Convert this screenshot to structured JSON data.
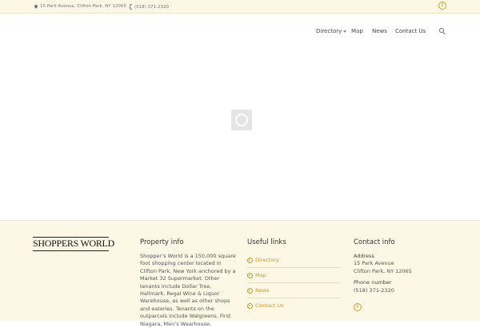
{
  "topbar": {
    "address": "15 Park Avenue, Clifton Park, NY 12065",
    "phone": "(518) 371-2320",
    "facebook_glyph": "f"
  },
  "nav": {
    "items": [
      "Directory",
      "Map",
      "News",
      "Contact Us"
    ]
  },
  "footer": {
    "logo_text": "SHOPPERS WORLD",
    "property": {
      "title": "Property info",
      "text": "Shopper’s World is a 150,000 square foot shopping center located in Clifton Park, New York anchored by a Market 32 Supermarket. Other tenants include Dollar Tree, Hallmark, Regal Wine & Liquor Warehouse, as well as other shops and eateries. Tenants on the outparcels include Walgreens, First Niagara, Men’s Wearhouse,"
    },
    "links": {
      "title": "Useful links",
      "items": [
        "Directory",
        "Map",
        "News",
        "Contact Us"
      ]
    },
    "contact": {
      "title": "Contact info",
      "address_label": "Address",
      "address_line1": "15 Park Avenue",
      "address_line2": "Clifton Park, NY 12065",
      "phone_label": "Phone number",
      "phone": "(518) 371-2320",
      "facebook_glyph": "f"
    }
  },
  "colors": {
    "accent": "#c39a1c",
    "cream": "#fdf8e6"
  }
}
